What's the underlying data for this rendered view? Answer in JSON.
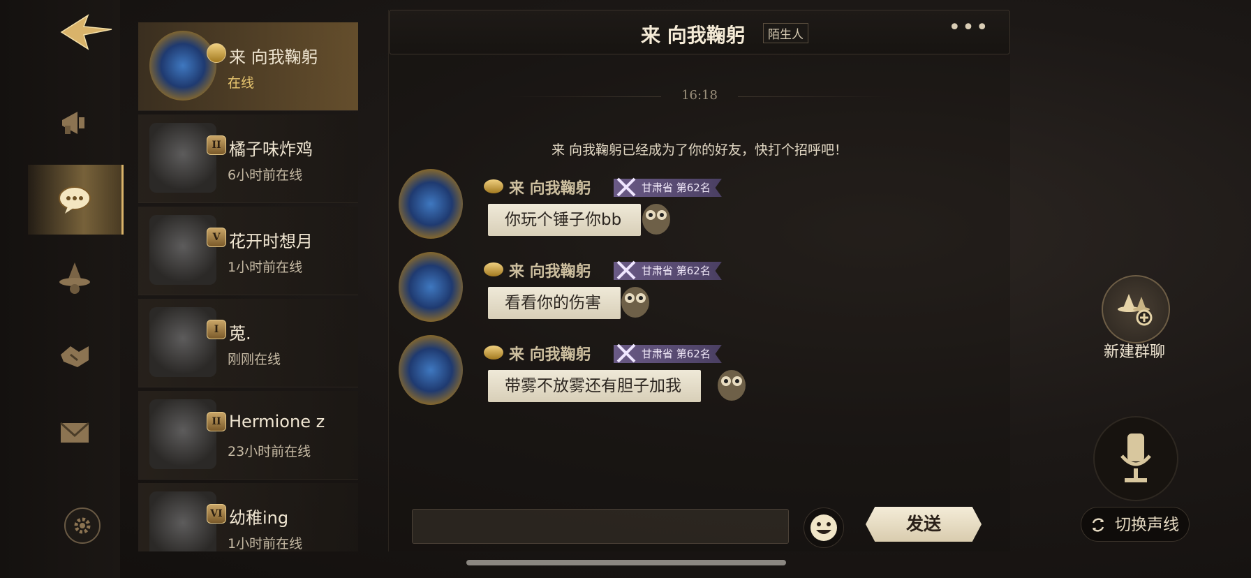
{
  "nav": {
    "icons": [
      "back-arrow-icon",
      "megaphone-icon",
      "chat-bubble-icon",
      "witch-hat-icon",
      "handshake-icon",
      "mail-icon",
      "gear-icon"
    ]
  },
  "friends": [
    {
      "name": "来 向我鞠躬",
      "status": "在线",
      "badge": "",
      "active": true
    },
    {
      "name": "橘子味炸鸡",
      "status": "6小时前在线",
      "badge": "II",
      "active": false
    },
    {
      "name": "花开时想月",
      "status": "1小时前在线",
      "badge": "V",
      "active": false
    },
    {
      "name": "莵.",
      "status": "刚刚在线",
      "badge": "I",
      "active": false
    },
    {
      "name": "Hermione z",
      "status": "23小时前在线",
      "badge": "II",
      "active": false
    },
    {
      "name": "幼稚ing",
      "status": "1小时前在线",
      "badge": "VI",
      "active": false
    }
  ],
  "chat": {
    "title": "来 向我鞠躬",
    "tag": "陌生人",
    "more": "•••",
    "timestamp": "16:18",
    "system_note": "来 向我鞠躬已经成为了你的好友，快打个招呼吧！",
    "messages": [
      {
        "sender": "来 向我鞠躬",
        "rank": "甘肃省 第62名",
        "text": "你玩个锤子你bb"
      },
      {
        "sender": "来 向我鞠躬",
        "rank": "甘肃省 第62名",
        "text": "看看你的伤害"
      },
      {
        "sender": "来 向我鞠躬",
        "rank": "甘肃省 第62名",
        "text": "带雾不放雾还有胆子加我"
      }
    ]
  },
  "input": {
    "value": "",
    "placeholder": ""
  },
  "send_label": "发送",
  "new_group_label": "新建群聊",
  "switch_voice_label": "切换声线",
  "colors": {
    "accent_gold": "#d9b36a",
    "bubble": "#efe9d8",
    "rank_tag": "#6a5a86"
  }
}
